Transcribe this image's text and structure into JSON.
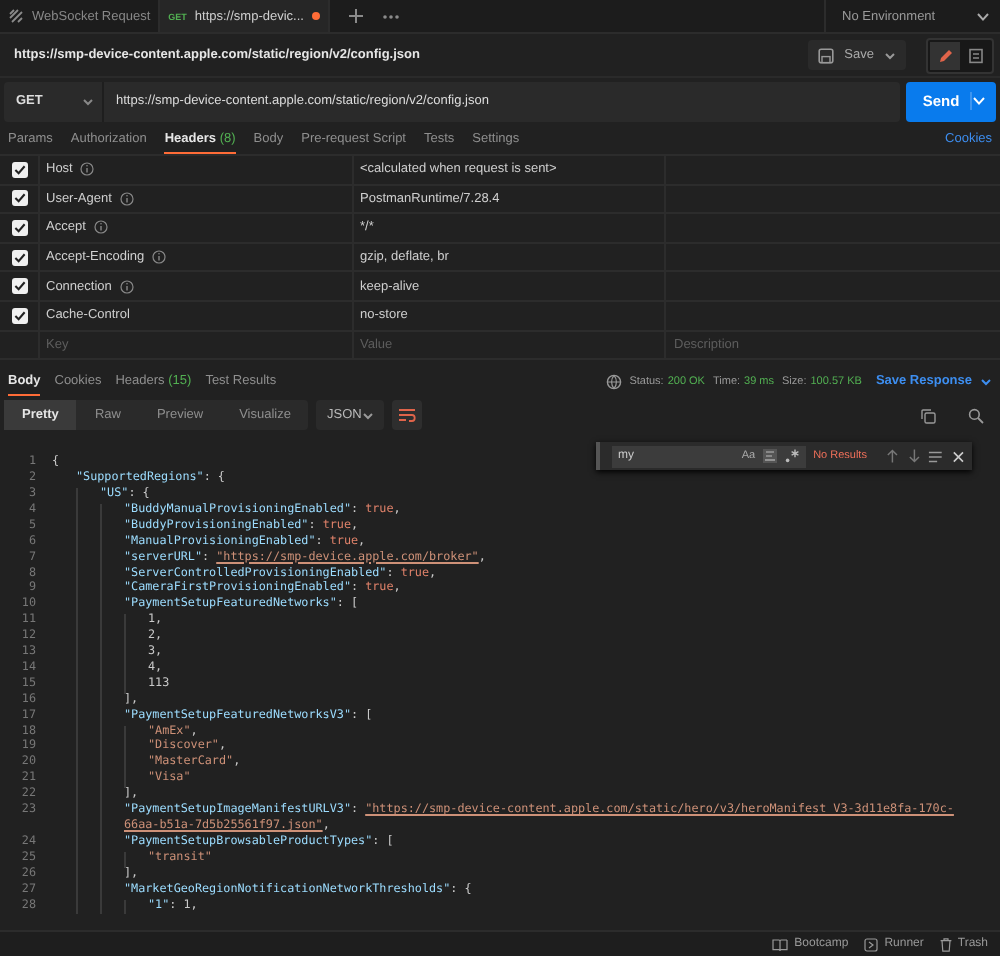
{
  "tabs": [
    {
      "kind": "websocket",
      "label": "WebSocket Request",
      "selected": false,
      "unsaved": false
    },
    {
      "kind": "http",
      "method": "GET",
      "label": "https://smp-devic...",
      "selected": true,
      "unsaved": true
    }
  ],
  "environment": "No Environment",
  "request": {
    "title": "https://smp-device-content.apple.com/static/region/v2/config.json",
    "save": "Save",
    "method": "GET",
    "url": "https://smp-device-content.apple.com/static/region/v2/config.json",
    "send": "Send"
  },
  "request_tabs": [
    {
      "label": "Params",
      "selected": false
    },
    {
      "label": "Authorization",
      "selected": false
    },
    {
      "label": "Headers",
      "count": "(8)",
      "selected": true
    },
    {
      "label": "Body",
      "selected": false
    },
    {
      "label": "Pre-request Script",
      "selected": false
    },
    {
      "label": "Tests",
      "selected": false
    },
    {
      "label": "Settings",
      "selected": false
    }
  ],
  "cookies_link": "Cookies",
  "headers": {
    "rows": [
      {
        "checked": true,
        "key": "Host",
        "info": true,
        "value": "<calculated when request is sent>"
      },
      {
        "checked": true,
        "key": "User-Agent",
        "info": true,
        "value": "PostmanRuntime/7.28.4"
      },
      {
        "checked": true,
        "key": "Accept",
        "info": true,
        "value": "*/*"
      },
      {
        "checked": true,
        "key": "Accept-Encoding",
        "info": true,
        "value": "gzip, deflate, br"
      },
      {
        "checked": true,
        "key": "Connection",
        "info": true,
        "value": "keep-alive"
      },
      {
        "checked": true,
        "key": "Cache-Control",
        "info": false,
        "value": "no-store"
      }
    ],
    "new_row": {
      "key": {
        "placeholder": "Key"
      },
      "value": {
        "placeholder": "Value"
      },
      "description": {
        "placeholder": "Description"
      }
    }
  },
  "response_tabs": [
    {
      "label": "Body",
      "selected": true
    },
    {
      "label": "Cookies",
      "selected": false
    },
    {
      "label": "Headers",
      "count": "(15)",
      "selected": false
    },
    {
      "label": "Test Results",
      "selected": false
    }
  ],
  "response_status": {
    "status_label": "Status:",
    "status": "200 OK",
    "time_label": "Time:",
    "time": "39 ms",
    "size_label": "Size:",
    "size": "100.57 KB"
  },
  "save_response": "Save Response",
  "view_modes": [
    {
      "label": "Pretty",
      "selected": true
    },
    {
      "label": "Raw",
      "selected": false
    },
    {
      "label": "Preview",
      "selected": false
    },
    {
      "label": "Visualize",
      "selected": false
    }
  ],
  "format": "JSON",
  "find": {
    "value": "my",
    "case_toggle": "Aa",
    "result": "No Results"
  },
  "code_lines": [
    {
      "number": "1",
      "tokens": [
        {
          "kind": "punct",
          "text": "{"
        }
      ]
    },
    {
      "number": "2",
      "tokens": [
        {
          "kind": "key",
          "text": "\"SupportedRegions\""
        },
        {
          "kind": "punct",
          "text": ": {"
        }
      ]
    },
    {
      "number": "3",
      "tokens": [
        {
          "kind": "key",
          "text": "\"US\""
        },
        {
          "kind": "punct",
          "text": ": {"
        }
      ]
    },
    {
      "number": "4",
      "tokens": [
        {
          "kind": "key",
          "text": "\"BuddyManualProvisioningEnabled\""
        },
        {
          "kind": "punct",
          "text": ": "
        },
        {
          "kind": "bool",
          "text": "true"
        },
        {
          "kind": "punct",
          "text": ","
        }
      ]
    },
    {
      "number": "5",
      "tokens": [
        {
          "kind": "key",
          "text": "\"BuddyProvisioningEnabled\""
        },
        {
          "kind": "punct",
          "text": ": "
        },
        {
          "kind": "bool",
          "text": "true"
        },
        {
          "kind": "punct",
          "text": ","
        }
      ]
    },
    {
      "number": "6",
      "tokens": [
        {
          "kind": "key",
          "text": "\"ManualProvisioningEnabled\""
        },
        {
          "kind": "punct",
          "text": ": "
        },
        {
          "kind": "bool",
          "text": "true"
        },
        {
          "kind": "punct",
          "text": ","
        }
      ]
    },
    {
      "number": "7",
      "tokens": [
        {
          "kind": "key",
          "text": "\"serverURL\""
        },
        {
          "kind": "punct",
          "text": ": "
        },
        {
          "kind": "link",
          "text": "\"https://smp-device.apple.com/broker\""
        },
        {
          "kind": "punct",
          "text": ","
        }
      ]
    },
    {
      "number": "8",
      "tokens": [
        {
          "kind": "key",
          "text": "\"ServerControlledProvisioningEnabled\""
        },
        {
          "kind": "punct",
          "text": ": "
        },
        {
          "kind": "bool",
          "text": "true"
        },
        {
          "kind": "punct",
          "text": ","
        }
      ]
    },
    {
      "number": "9",
      "tokens": [
        {
          "kind": "key",
          "text": "\"CameraFirstProvisioningEnabled\""
        },
        {
          "kind": "punct",
          "text": ": "
        },
        {
          "kind": "bool",
          "text": "true"
        },
        {
          "kind": "punct",
          "text": ","
        }
      ]
    },
    {
      "number": "10",
      "tokens": [
        {
          "kind": "key",
          "text": "\"PaymentSetupFeaturedNetworks\""
        },
        {
          "kind": "punct",
          "text": ": ["
        }
      ]
    },
    {
      "number": "11",
      "tokens": [
        {
          "kind": "number",
          "text": "1"
        },
        {
          "kind": "punct",
          "text": ","
        }
      ]
    },
    {
      "number": "12",
      "tokens": [
        {
          "kind": "number",
          "text": "2"
        },
        {
          "kind": "punct",
          "text": ","
        }
      ]
    },
    {
      "number": "13",
      "tokens": [
        {
          "kind": "number",
          "text": "3"
        },
        {
          "kind": "punct",
          "text": ","
        }
      ]
    },
    {
      "number": "14",
      "tokens": [
        {
          "kind": "number",
          "text": "4"
        },
        {
          "kind": "punct",
          "text": ","
        }
      ]
    },
    {
      "number": "15",
      "tokens": [
        {
          "kind": "number",
          "text": "113"
        }
      ]
    },
    {
      "number": "16",
      "tokens": [
        {
          "kind": "punct",
          "text": "],"
        }
      ]
    },
    {
      "number": "17",
      "tokens": [
        {
          "kind": "key",
          "text": "\"PaymentSetupFeaturedNetworksV3\""
        },
        {
          "kind": "punct",
          "text": ": ["
        }
      ]
    },
    {
      "number": "18",
      "tokens": [
        {
          "kind": "string",
          "text": "\"AmEx\""
        },
        {
          "kind": "punct",
          "text": ","
        }
      ]
    },
    {
      "number": "19",
      "tokens": [
        {
          "kind": "string",
          "text": "\"Discover\""
        },
        {
          "kind": "punct",
          "text": ","
        }
      ]
    },
    {
      "number": "20",
      "tokens": [
        {
          "kind": "string",
          "text": "\"MasterCard\""
        },
        {
          "kind": "punct",
          "text": ","
        }
      ]
    },
    {
      "number": "21",
      "tokens": [
        {
          "kind": "string",
          "text": "\"Visa\""
        }
      ]
    },
    {
      "number": "22",
      "tokens": [
        {
          "kind": "punct",
          "text": "],"
        }
      ]
    },
    {
      "number": "23",
      "tokens": [
        {
          "kind": "key",
          "text": "\"PaymentSetupImageManifestURLV3\""
        },
        {
          "kind": "punct",
          "text": ": "
        },
        {
          "kind": "link",
          "text": "\"https://smp-device-content.apple.com/static/hero/v3/heroManifest_V3-3d11e8fa-170c-66aa-b51a-7d5b25561f97.json\""
        },
        {
          "kind": "punct",
          "text": ","
        }
      ]
    },
    {
      "number": "24",
      "tokens": [
        {
          "kind": "key",
          "text": "\"PaymentSetupBrowsableProductTypes\""
        },
        {
          "kind": "punct",
          "text": ": ["
        }
      ]
    },
    {
      "number": "25",
      "tokens": [
        {
          "kind": "string",
          "text": "\"transit\""
        }
      ]
    },
    {
      "number": "26",
      "tokens": [
        {
          "kind": "punct",
          "text": "],"
        }
      ]
    },
    {
      "number": "27",
      "tokens": [
        {
          "kind": "key",
          "text": "\"MarketGeoRegionNotificationNetworkThresholds\""
        },
        {
          "kind": "punct",
          "text": ": {"
        }
      ]
    },
    {
      "number": "28",
      "tokens": [
        {
          "kind": "key",
          "text": "\"1\""
        },
        {
          "kind": "punct",
          "text": ": "
        },
        {
          "kind": "number",
          "text": "1"
        },
        {
          "kind": "punct",
          "text": ","
        }
      ]
    }
  ],
  "status_bar": [
    {
      "kind": "bootcamp",
      "label": "Bootcamp"
    },
    {
      "kind": "runner",
      "label": "Runner"
    },
    {
      "kind": "trash",
      "label": "Trash"
    }
  ]
}
